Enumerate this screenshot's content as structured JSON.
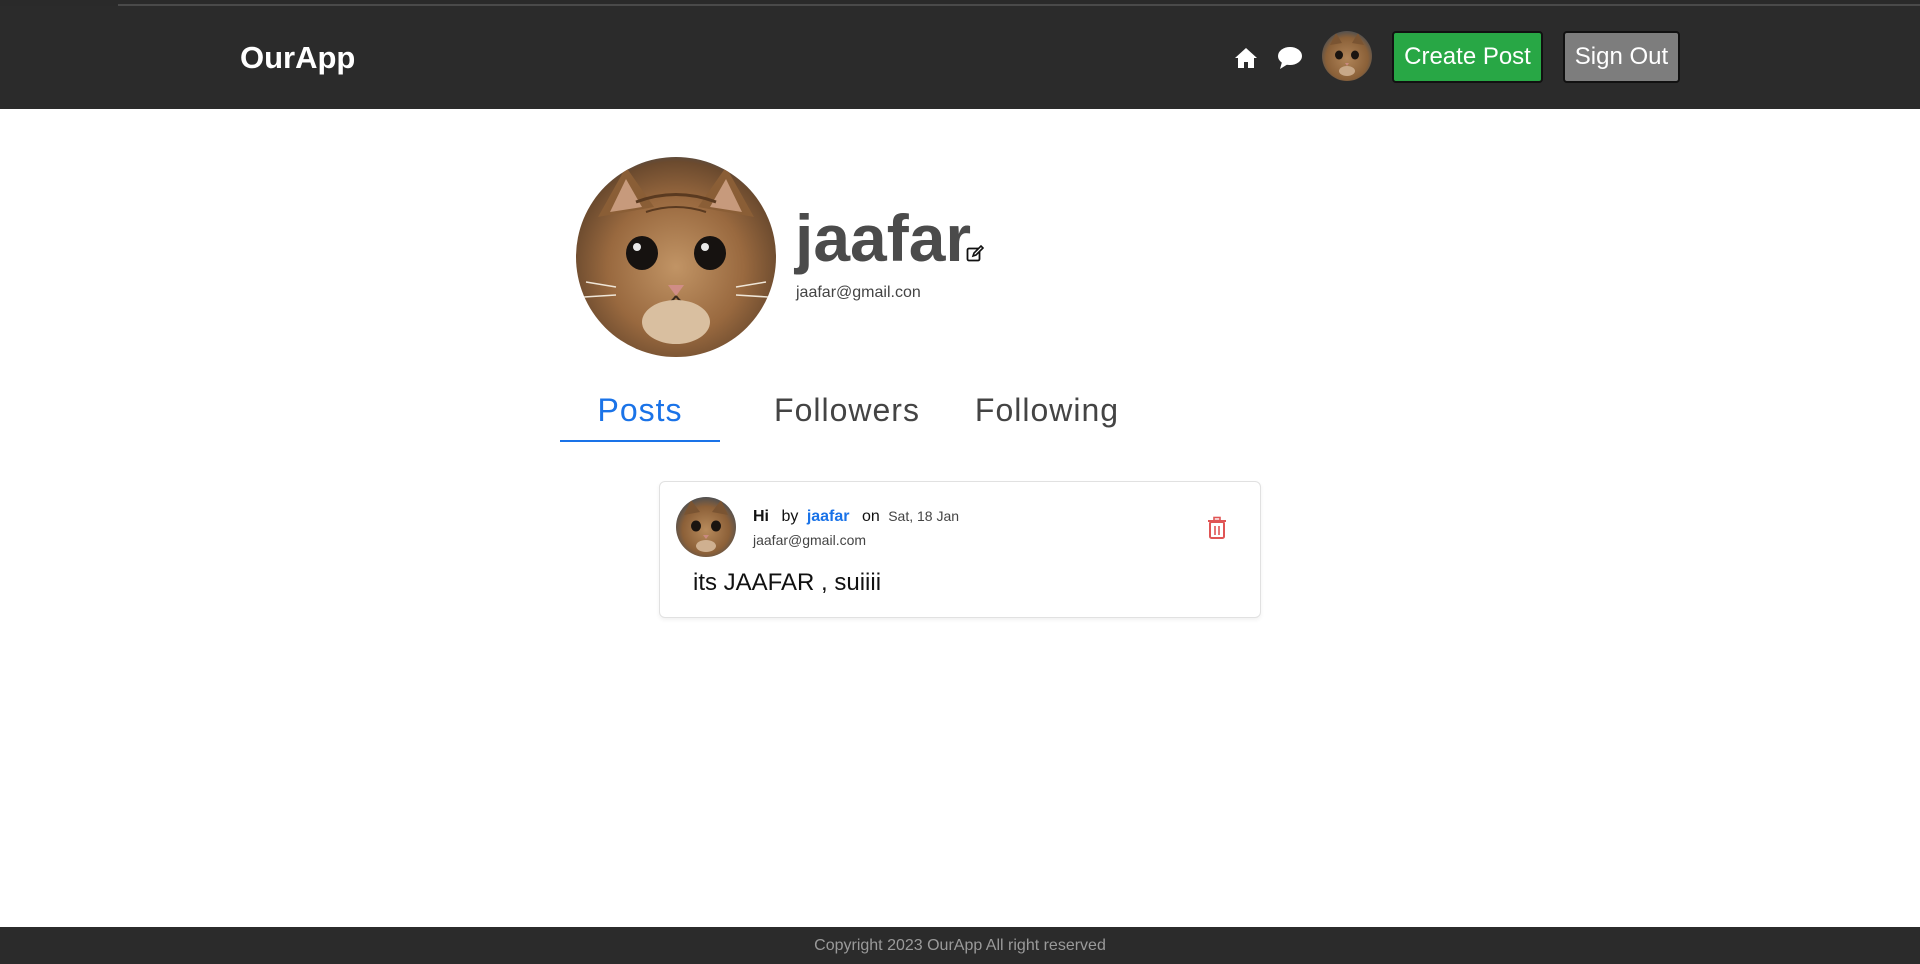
{
  "header": {
    "brand": "OurApp",
    "icons": [
      "home-icon",
      "chat-icon"
    ],
    "create_post_label": "Create Post",
    "sign_out_label": "Sign Out"
  },
  "profile": {
    "username": "jaafar",
    "email": "jaafar@gmail.con",
    "edit_icon": "edit-icon"
  },
  "tabs": [
    {
      "label": "Posts",
      "active": true
    },
    {
      "label": "Followers",
      "active": false
    },
    {
      "label": "Following",
      "active": false
    }
  ],
  "posts": [
    {
      "title": "Hi",
      "by_label": "by",
      "author": "jaafar",
      "on_label": "on",
      "date": "Sat, 18 Jan",
      "email": "jaafar@gmail.com",
      "body": "its JAAFAR , suiiii",
      "delete_icon": "trash-icon"
    }
  ],
  "footer": {
    "copyright": "Copyright 2023 OurApp All right reserved"
  },
  "colors": {
    "header_bg": "#2b2b2b",
    "create_button": "#28a745",
    "sign_out_button": "#7d7d7d",
    "accent": "#1a73e8",
    "delete": "#e05555"
  }
}
